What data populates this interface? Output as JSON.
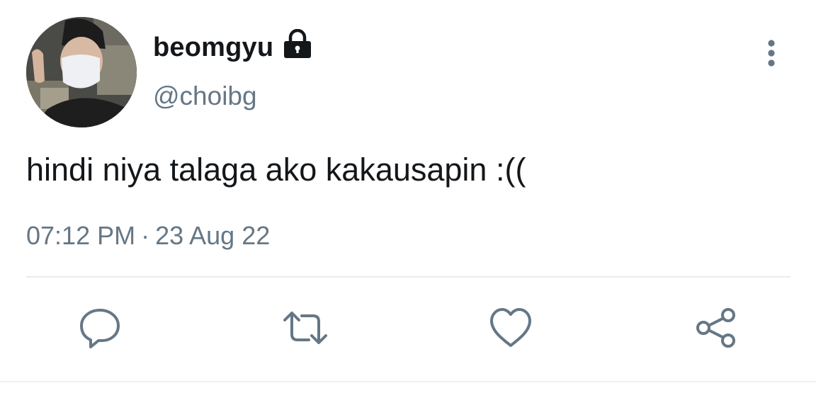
{
  "tweet": {
    "author": {
      "display_name": "beomgyu",
      "handle": "@choibg",
      "protected_icon": "lock-icon",
      "avatar": "profile-photo"
    },
    "text": "hindi niya talaga ako kakausapin :((",
    "time": "07:12 PM",
    "separator": "·",
    "date": "23 Aug 22",
    "menu_icon": "more-vertical-icon",
    "actions": [
      {
        "name": "reply",
        "icon": "comment-icon"
      },
      {
        "name": "retweet",
        "icon": "retweet-icon"
      },
      {
        "name": "like",
        "icon": "heart-icon"
      },
      {
        "name": "share",
        "icon": "share-icon"
      }
    ]
  },
  "colors": {
    "primary_text": "#14171a",
    "secondary_text": "#657786",
    "divider": "#e6ecf0"
  }
}
